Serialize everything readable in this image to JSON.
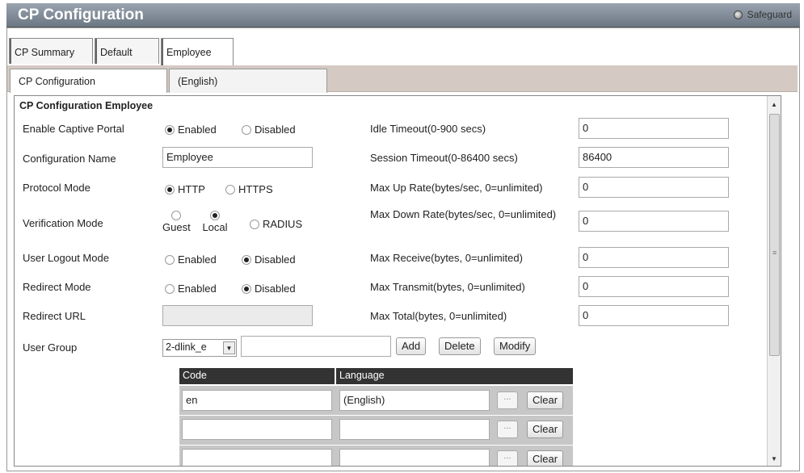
{
  "window": {
    "title": "CP Configuration",
    "badge": "Safeguard"
  },
  "tabs": [
    {
      "label": "CP Summary"
    },
    {
      "label": "Default"
    },
    {
      "label": "Employee"
    }
  ],
  "subtabs": [
    {
      "label": "CP Configuration"
    },
    {
      "label": "(English)"
    }
  ],
  "section_title": "CP Configuration Employee",
  "left": {
    "enable": {
      "label": "Enable Captive Portal",
      "opt1": "Enabled",
      "opt2": "Disabled",
      "selected": "Enabled"
    },
    "config_name": {
      "label": "Configuration Name",
      "value": "Employee"
    },
    "protocol": {
      "label": "Protocol Mode",
      "opt1": "HTTP",
      "opt2": "HTTPS",
      "selected": "HTTP"
    },
    "verification": {
      "label": "Verification Mode",
      "opt1": "Guest",
      "opt2": "Local",
      "opt3": "RADIUS",
      "selected": "Local"
    },
    "logout": {
      "label": "User Logout Mode",
      "opt1": "Enabled",
      "opt2": "Disabled",
      "selected": "Disabled"
    },
    "redirect": {
      "label": "Redirect Mode",
      "opt1": "Enabled",
      "opt2": "Disabled",
      "selected": "Disabled"
    },
    "redirect_url": {
      "label": "Redirect URL",
      "value": ""
    },
    "user_group": {
      "label": "User Group",
      "selected": "2-dlink_e",
      "input": "",
      "add": "Add",
      "delete": "Delete",
      "modify": "Modify"
    }
  },
  "right": {
    "idle": {
      "label": "Idle Timeout(0-900 secs)",
      "value": "0"
    },
    "session": {
      "label": "Session Timeout(0-86400 secs)",
      "value": "86400"
    },
    "up_rate": {
      "label": "Max Up Rate(bytes/sec, 0=unlimited)",
      "value": "0"
    },
    "down_rate": {
      "label": "Max Down Rate(bytes/sec, 0=unlimited)",
      "value": "0"
    },
    "receive": {
      "label": "Max Receive(bytes, 0=unlimited)",
      "value": "0"
    },
    "transmit": {
      "label": "Max Transmit(bytes, 0=unlimited)",
      "value": "0"
    },
    "total": {
      "label": "Max Total(bytes, 0=unlimited)",
      "value": "0"
    }
  },
  "lang_table": {
    "headers": [
      "Code",
      "Language"
    ],
    "rows": [
      {
        "code": "en",
        "language": "(English)",
        "browse": "...",
        "clear": "Clear"
      },
      {
        "code": "",
        "language": "",
        "browse": "...",
        "clear": "Clear"
      },
      {
        "code": "",
        "language": "",
        "browse": "...",
        "clear": "Clear"
      }
    ]
  }
}
